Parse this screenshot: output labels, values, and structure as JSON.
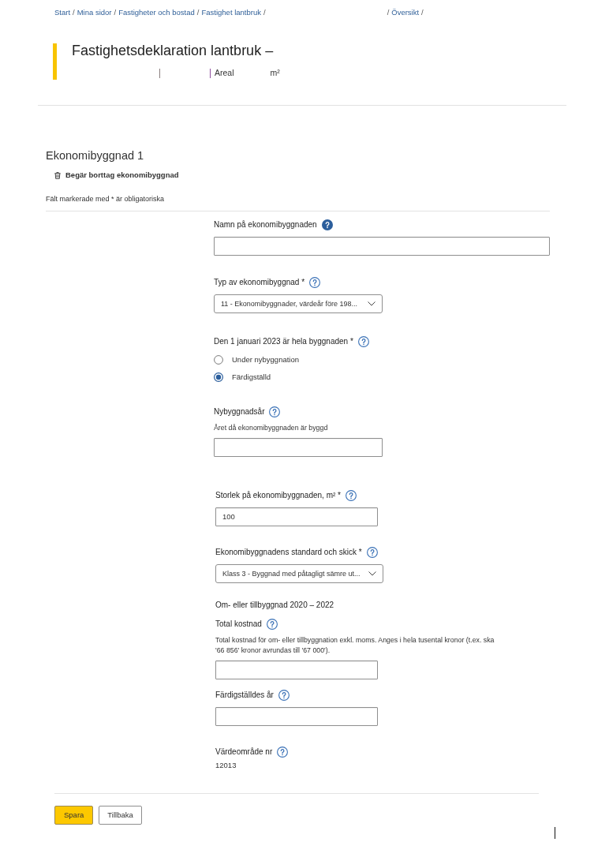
{
  "breadcrumb": [
    {
      "kind": "link",
      "text": "Start"
    },
    {
      "kind": "separator",
      "text": "/"
    },
    {
      "kind": "link",
      "text": "Mina sidor"
    },
    {
      "kind": "separator",
      "text": "/"
    },
    {
      "kind": "link",
      "text": "Fastigheter och bostad"
    },
    {
      "kind": "separator",
      "text": "/"
    },
    {
      "kind": "link",
      "text": "Fastighet lantbruk"
    },
    {
      "kind": "separator",
      "text": "/"
    },
    {
      "kind": "gap"
    },
    {
      "kind": "separator",
      "text": "/"
    },
    {
      "kind": "link",
      "text": "Översikt"
    },
    {
      "kind": "separator",
      "text": "/"
    }
  ],
  "header": {
    "title": "Fastighetsdeklaration lantbruk –",
    "subtitle": [
      {
        "kind": "gap"
      },
      {
        "kind": "divider",
        "color": "#8b7f7f"
      },
      {
        "kind": "gap"
      },
      {
        "kind": "divider",
        "color": "#8e4f9e"
      },
      {
        "kind": "text",
        "text": "Areal"
      },
      {
        "kind": "gap"
      },
      {
        "kind": "text",
        "text": "m²"
      }
    ]
  },
  "section": {
    "title": "Ekonomibyggnad 1",
    "remove_action": "Begär borttag ekonomibyggnad",
    "required_note": "Fält markerade med * är obligatoriska"
  },
  "fields": [
    {
      "kind": "text",
      "label": "Namn på ekonomibyggnaden",
      "help": true,
      "help_active": true
    },
    {
      "kind": "select",
      "label": "Typ av ekonomibyggnad *",
      "help": true,
      "help_active": false,
      "value": "11 - Ekonomibyggnader, värdeår före 198..."
    },
    {
      "kind": "radio",
      "label": "Den 1 januari 2023 är hela byggnaden *",
      "help": true,
      "help_active": false,
      "options": [
        {
          "label": "Under nybyggnation",
          "selected": false
        },
        {
          "label": "Färdigställd",
          "selected": true
        }
      ]
    },
    {
      "kind": "text",
      "label": "Nybyggnadsår",
      "help": true,
      "help_active": false,
      "hint": "Året då ekonomibyggnaden är byggd"
    },
    {
      "kind": "text",
      "label": "Storlek på ekonomibyggnaden, m² *",
      "help": true,
      "help_active": false,
      "value": "100"
    },
    {
      "kind": "select",
      "label": "Ekonomibyggnadens standard och skick *",
      "help": true,
      "help_active": false,
      "value": "Klass 3 - Byggnad med påtagligt sämre ut..."
    },
    {
      "kind": "heading",
      "label": "Om- eller tillbyggnad 2020 – 2022"
    },
    {
      "kind": "text",
      "label": "Total kostnad",
      "help": true,
      "help_active": false,
      "hint": "Total kostnad för om- eller tillbyggnation exkl. moms. Anges i hela tusental kronor (t.ex. ska '66 856' kronor avrundas till '67 000')."
    },
    {
      "kind": "text",
      "label": "Färdigställdes år",
      "help": true,
      "help_active": false
    },
    {
      "kind": "static",
      "label": "Värdeområde nr",
      "help": true,
      "help_active": false,
      "value": "12013"
    }
  ],
  "buttons": [
    {
      "kind": "primary",
      "label": "Spara"
    },
    {
      "kind": "secondary",
      "label": "Tillbaka"
    }
  ]
}
